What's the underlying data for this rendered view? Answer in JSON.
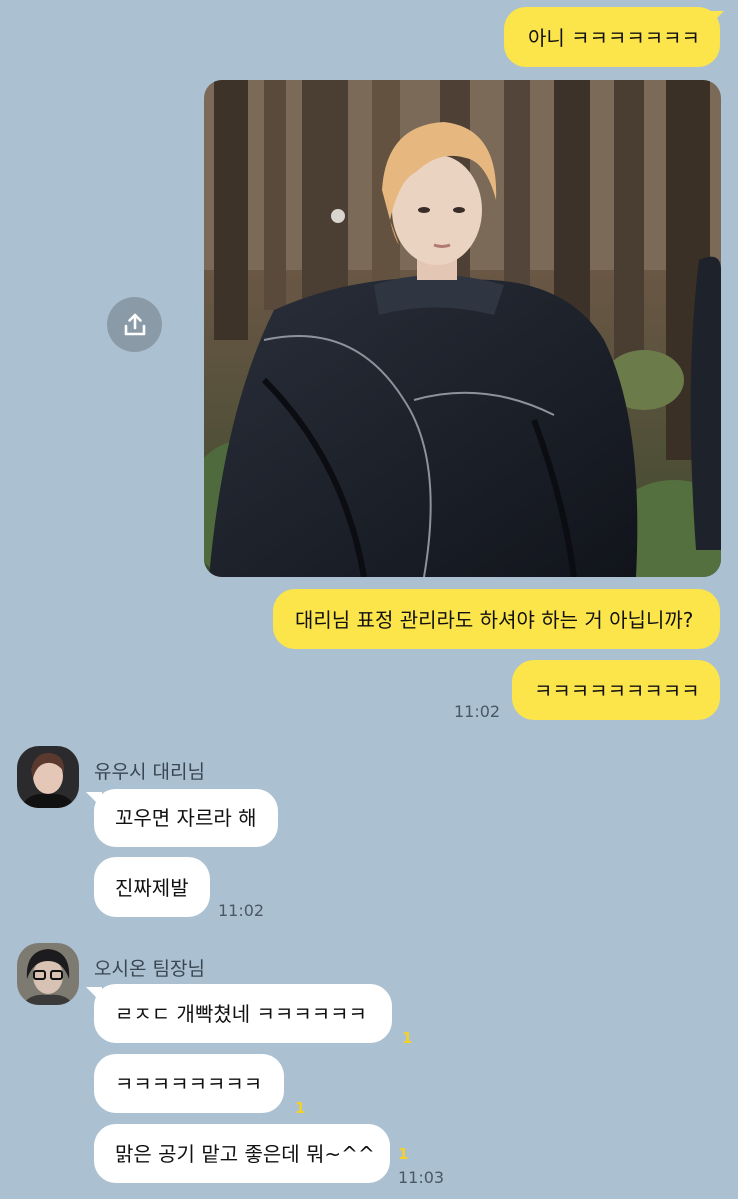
{
  "messages_out": [
    {
      "text": "아니 ㅋㅋㅋㅋㅋㅋㅋ"
    },
    {
      "text": "대리님 표정 관리라도 하셔야 하는 거 아닙니까?"
    },
    {
      "text": "ㅋㅋㅋㅋㅋㅋㅋㅋㅋ",
      "time": "11:02"
    }
  ],
  "image_message": {
    "share_icon": "share-upload-icon",
    "description": "photo"
  },
  "conversation": [
    {
      "sender": "유우시 대리님",
      "messages": [
        {
          "text": "꼬우면 자르라 해"
        },
        {
          "text": "진짜제발",
          "time": "11:02"
        }
      ]
    },
    {
      "sender": "오시온 팀장님",
      "messages": [
        {
          "text": "ㄹㅈㄷ 개빡쳤네 ㅋㅋㅋㅋㅋㅋ",
          "unread": "1"
        },
        {
          "text": "ㅋㅋㅋㅋㅋㅋㅋㅋ",
          "unread": "1"
        },
        {
          "text": "맑은 공기 맡고 좋은데 뭐~^^",
          "unread": "1",
          "time": "11:03"
        }
      ]
    }
  ],
  "colors": {
    "background": "#abc1d1",
    "outgoing_bubble": "#fce54a",
    "incoming_bubble": "#ffffff",
    "unread": "#f3d02a"
  }
}
